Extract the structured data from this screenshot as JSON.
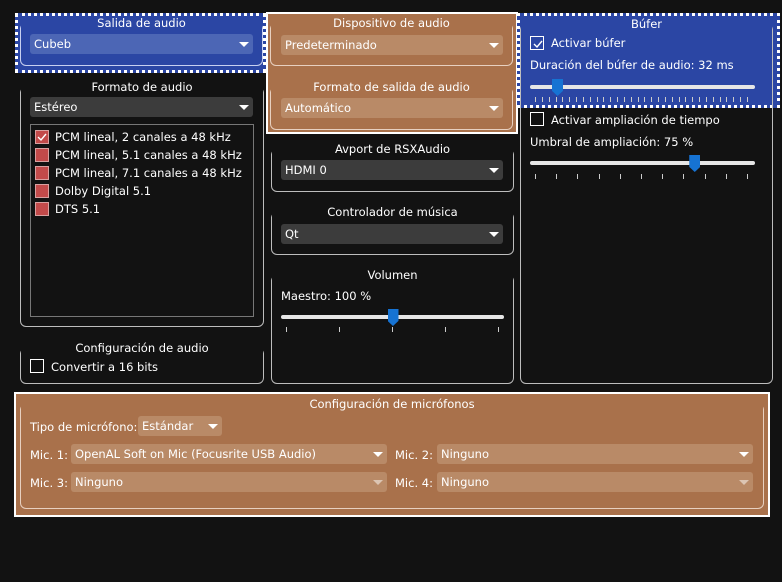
{
  "audio_output": {
    "title": "Salida de audio",
    "value": "Cubeb"
  },
  "audio_device": {
    "title": "Dispositivo de audio",
    "value": "Predeterminado"
  },
  "audio_output_format": {
    "title": "Formato de salida de audio",
    "value": "Automático"
  },
  "buffer": {
    "title": "Búfer",
    "enable_buffer_label": "Activar búfer",
    "enable_buffer_checked": true,
    "duration_label": "Duración del búfer de audio: 32 ms",
    "duration_fraction": 0.12,
    "enable_stretch_label": "Activar ampliación de tiempo",
    "enable_stretch_checked": false,
    "threshold_label": "Umbral de ampliación: 75 %",
    "threshold_fraction": 0.73
  },
  "audio_format": {
    "title": "Formato de audio",
    "value": "Estéreo",
    "items": [
      {
        "label": "PCM lineal, 2 canales a 48 kHz",
        "checked": true
      },
      {
        "label": "PCM lineal, 5.1 canales a 48 kHz",
        "checked": false
      },
      {
        "label": "PCM lineal, 7.1 canales a 48 kHz",
        "checked": false
      },
      {
        "label": "Dolby Digital 5.1",
        "checked": false
      },
      {
        "label": "DTS 5.1",
        "checked": false
      }
    ]
  },
  "avport": {
    "title": "Avport de RSXAudio",
    "value": "HDMI 0"
  },
  "music_driver": {
    "title": "Controlador de música",
    "value": "Qt"
  },
  "volume": {
    "title": "Volumen",
    "master_label": "Maestro: 100 %",
    "master_fraction": 0.5
  },
  "audio_config": {
    "title": "Configuración de audio",
    "convert_label": "Convertir a 16 bits",
    "convert_checked": false
  },
  "mic_config": {
    "title": "Configuración de micrófonos",
    "type_label": "Tipo de micrófono:",
    "type_value": "Estándar",
    "mic1_label": "Mic. 1:",
    "mic1_value": "OpenAL Soft on Mic (Focusrite USB Audio)",
    "mic2_label": "Mic. 2:",
    "mic2_value": "Ninguno",
    "mic3_label": "Mic. 3:",
    "mic3_value": "Ninguno",
    "mic4_label": "Mic. 4:",
    "mic4_value": "Ninguno"
  },
  "colors": {
    "highlight_blue": "#2b46a4",
    "highlight_brown": "#a9714b",
    "slider_handle": "#1673d3",
    "checkbox_red": "#c24a4a"
  }
}
